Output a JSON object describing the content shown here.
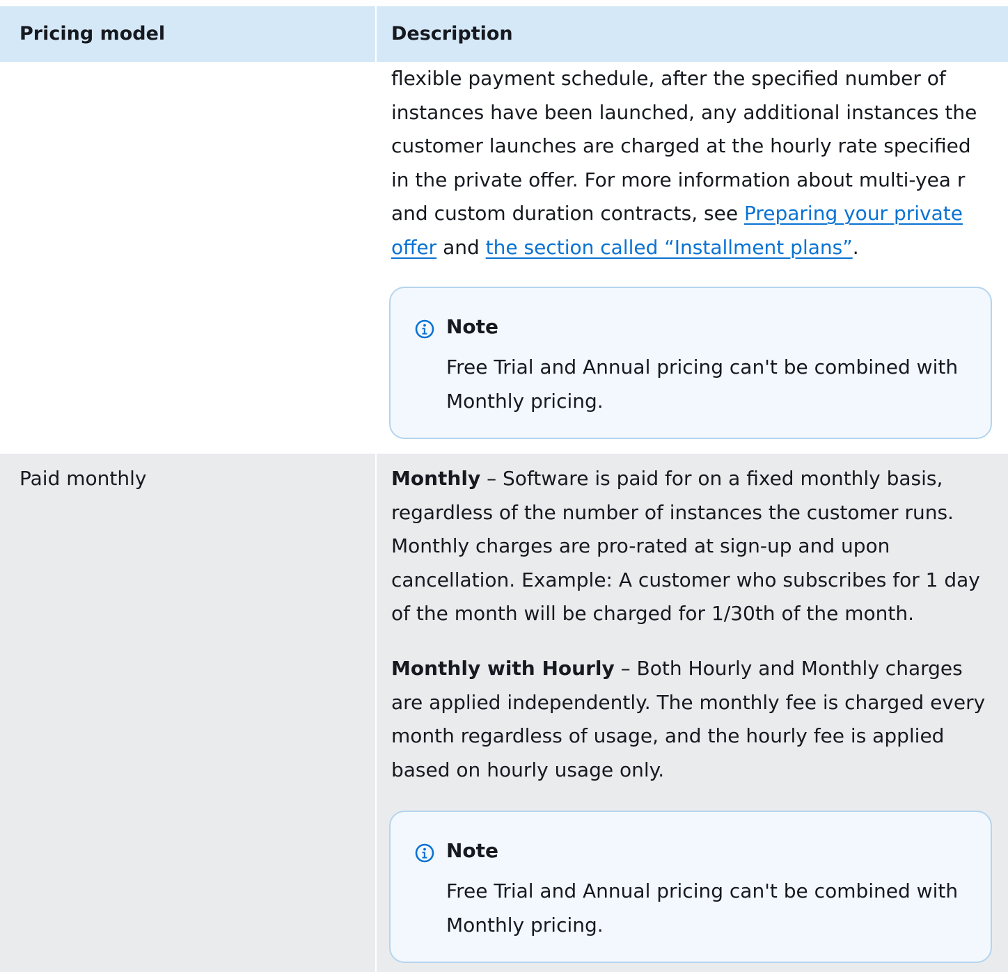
{
  "table": {
    "headers": {
      "pricing_model": "Pricing model",
      "description": "Description"
    },
    "row_continued": {
      "text_before_link1": "flexible payment schedule, after the specified number of instances have been launched, any additional instances the customer launches are charged at the hourly rate specified  in the private offer. For more information about multi-yea r and custom duration contracts, see ",
      "link1": "Preparing your private offer",
      "text_between": " and ",
      "link2": "the section called “Installment plans”",
      "text_after": ".",
      "note": {
        "icon": "info-icon",
        "title": "Note",
        "body": "Free Trial and Annual pricing can't be combined with Monthly pricing."
      }
    },
    "row_paid_monthly": {
      "model": "Paid monthly",
      "monthly_term": "Monthly",
      "monthly_desc": " – Software is paid for on a fixed monthly basis, regardless of the number of instances the customer runs. Monthly charges are pro-rated at sign-up and upon cancellation. Example: A customer who subscribes for 1 day of the month will be charged for 1/30th of the month.",
      "monthly_hourly_term": "Monthly with Hourly",
      "monthly_hourly_desc": " – Both Hourly and Monthly charges are applied independently. The monthly fee is charged every month regardless of usage, and the hourly fee is applied based on hourly usage only.",
      "note": {
        "icon": "info-icon",
        "title": "Note",
        "body": "Free Trial and Annual pricing can't be combined with Monthly pricing."
      }
    }
  },
  "colors": {
    "header_bg": "#d5e8f7",
    "alt_row_bg": "#e9ebed",
    "link": "#0972d3",
    "note_bg": "#f2f8fd",
    "note_border": "#b4d4ef",
    "info_icon": "#0972d3"
  }
}
